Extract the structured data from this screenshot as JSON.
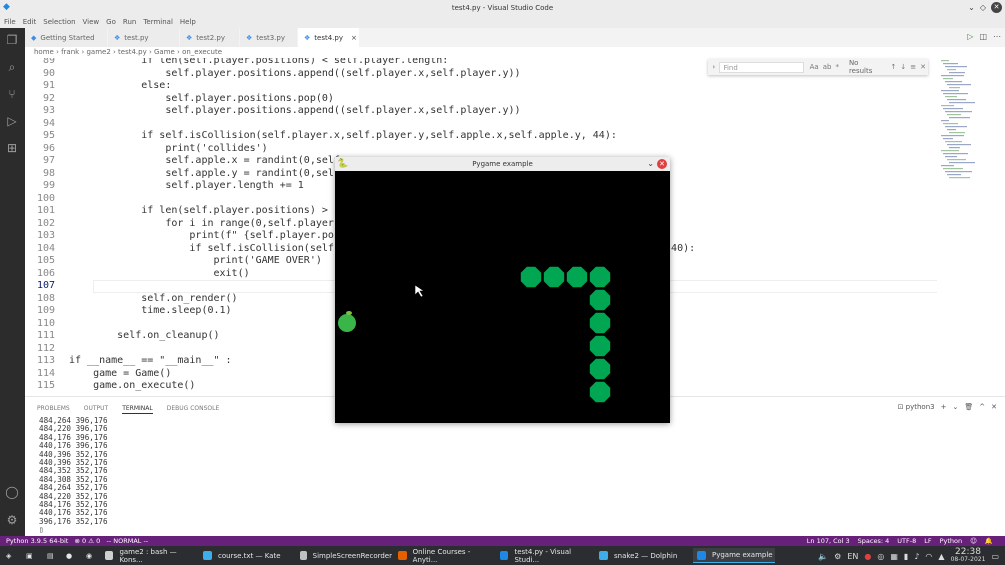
{
  "window": {
    "title": "test4.py - Visual Studio Code"
  },
  "menu": [
    "File",
    "Edit",
    "Selection",
    "View",
    "Go",
    "Run",
    "Terminal",
    "Help"
  ],
  "tabs": [
    {
      "label": "Getting Started",
      "icon": "vscode-icon",
      "active": false
    },
    {
      "label": "test.py",
      "icon": "python-icon",
      "active": false
    },
    {
      "label": "test2.py",
      "icon": "python-icon",
      "active": false
    },
    {
      "label": "test3.py",
      "icon": "python-icon",
      "active": false
    },
    {
      "label": "test4.py",
      "icon": "python-icon",
      "active": true,
      "close": "×"
    }
  ],
  "breadcrumb": {
    "text": "home › frank › game2 › test4.py › Game › on_execute"
  },
  "find": {
    "placeholder": "Find",
    "result": "No results",
    "opts": [
      "Aa",
      "ab",
      "*"
    ]
  },
  "code": [
    {
      "n": "89",
      "t": "            if len(self.player.positions) < self.player.length:"
    },
    {
      "n": "90",
      "t": "                self.player.positions.append((self.player.x,self.player.y))"
    },
    {
      "n": "91",
      "t": "            else:"
    },
    {
      "n": "92",
      "t": "                self.player.positions.pop(0)"
    },
    {
      "n": "93",
      "t": "                self.player.positions.append((self.player.x,self.player.y))"
    },
    {
      "n": "94",
      "t": ""
    },
    {
      "n": "95",
      "t": "            if self.isCollision(self.player.x,self.player.y,self.apple.x,self.apple.y, 44):"
    },
    {
      "n": "96",
      "t": "                print('collides')"
    },
    {
      "n": "97",
      "t": "                self.apple.x = randint(0,self.g"
    },
    {
      "n": "98",
      "t": "                self.apple.y = randint(0,self.g"
    },
    {
      "n": "99",
      "t": "                self.player.length += 1"
    },
    {
      "n": "100",
      "t": ""
    },
    {
      "n": "101",
      "t": "            if len(self.player.positions) > sel"
    },
    {
      "n": "102",
      "t": "                for i in range(0,self.player.le"
    },
    {
      "n": "103",
      "t": "                    print(f\" {self.player.posit                                   self.player.y}\")"
    },
    {
      "n": "104",
      "t": "                    if self.isCollision(self.pl                                  er.positions[i][1],40):"
    },
    {
      "n": "105",
      "t": "                        print('GAME OVER')"
    },
    {
      "n": "106",
      "t": "                        exit()"
    },
    {
      "n": "107",
      "t": ""
    },
    {
      "n": "108",
      "t": "            self.on_render()"
    },
    {
      "n": "109",
      "t": "            time.sleep(0.1)"
    },
    {
      "n": "110",
      "t": ""
    },
    {
      "n": "111",
      "t": "        self.on_cleanup()"
    },
    {
      "n": "112",
      "t": ""
    },
    {
      "n": "113",
      "t": "if __name__ == \"__main__\" :"
    },
    {
      "n": "114",
      "t": "    game = Game()"
    },
    {
      "n": "115",
      "t": "    game.on_execute()"
    }
  ],
  "panel": {
    "tabs": [
      "PROBLEMS",
      "OUTPUT",
      "TERMINAL",
      "DEBUG CONSOLE"
    ],
    "shell": "python3",
    "lines": [
      "484,264 396,176",
      "484,220 396,176",
      "484,176 396,176",
      "440,176 396,176",
      "440,396 352,176",
      "440,396 352,176",
      "484,352 352,176",
      "484,308 352,176",
      "484,264 352,176",
      "484,220 352,176",
      "484,176 352,176",
      "440,176 352,176",
      "396,176 352,176"
    ]
  },
  "status": {
    "python": "Python 3.9.5 64-bit",
    "problems": "⊗ 0 ⚠ 0",
    "mode": "-- NORMAL --",
    "right": [
      "Ln 107, Col 3",
      "Spaces: 4",
      "UTF-8",
      "LF",
      "Python"
    ]
  },
  "pygame": {
    "title": "Pygame example",
    "bg": "#000000",
    "snake_color": "#00a651",
    "apple_color": "#39b54a",
    "snake_cells": [
      [
        1,
        0
      ],
      [
        2,
        0
      ],
      [
        3,
        0
      ],
      [
        4,
        0
      ],
      [
        4,
        1
      ],
      [
        4,
        2
      ],
      [
        4,
        3
      ],
      [
        4,
        4
      ],
      [
        4,
        5
      ]
    ]
  },
  "taskbar": {
    "items": [
      {
        "label": "game2 : bash — Kons...",
        "color": "#cfcfcf"
      },
      {
        "label": "course.txt — Kate",
        "color": "#3daee9"
      },
      {
        "label": "SimpleScreenRecorder",
        "color": "#c0c0c0"
      },
      {
        "label": "Online Courses - Anyti...",
        "color": "#e66000"
      },
      {
        "label": "test4.py - Visual Studi...",
        "color": "#1e88e5"
      },
      {
        "label": "snake2 — Dolphin",
        "color": "#3daee9"
      },
      {
        "label": "Pygame example",
        "color": "#1e88e5",
        "active": true
      }
    ],
    "lang": "EN",
    "time": "22:38",
    "date": "08-07-2021"
  }
}
